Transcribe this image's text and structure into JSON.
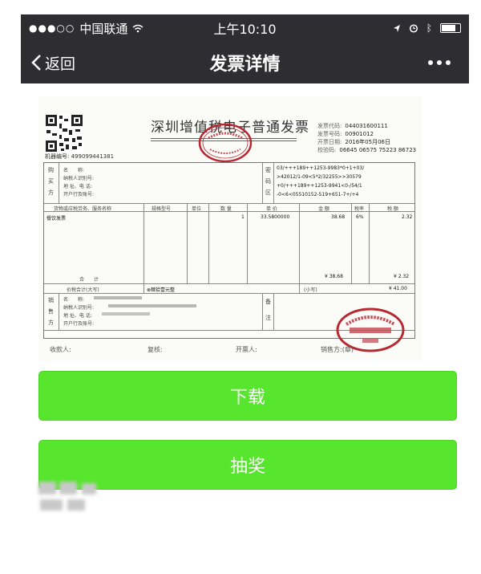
{
  "status_bar": {
    "carrier": "中国联通",
    "time": "上午10:10"
  },
  "nav": {
    "back_label": "返回",
    "title": "发票详情",
    "more_label": "•••"
  },
  "invoice": {
    "title": "深圳增值税电子普通发票",
    "meta": [
      {
        "k": "发票代码:",
        "v": "044031600111"
      },
      {
        "k": "发票号码:",
        "v": "00901012"
      },
      {
        "k": "开票日期:",
        "v": "2016年05月06日"
      },
      {
        "k": "校验码:",
        "v": "06645 06575 75223 86723"
      }
    ],
    "machine_no": "机器编号: 499099441381",
    "buyer_label": [
      "购",
      "买",
      "方"
    ],
    "buyer_fields": [
      "名　　称:",
      "纳税人识别号:",
      "地 址、电 话:",
      "开户行及账号:"
    ],
    "cipher_label": [
      "密",
      "码",
      "区"
    ],
    "cipher_lines": [
      "03/+++189++1253-9983*0+1+03/",
      ">42012/1-09<5*2/32255>>30579",
      "+0/+++189++1253-9941<0-/54/1",
      "-0<6<05510152-519+651-7+/+4"
    ],
    "item_headers": [
      "货物或应税劳务、服务名称",
      "规格型号",
      "单位",
      "数 量",
      "单 价",
      "金 额",
      "税率",
      "税 额"
    ],
    "item_row": {
      "name": "餐饮发票",
      "qty": "1",
      "price": "33.5800000",
      "amount": "38.68",
      "rate": "6%",
      "tax": "2.32"
    },
    "subtotal_label": "合　　计",
    "subtotal_amount": "¥ 38.68",
    "subtotal_tax": "¥ 2.32",
    "total_label": "价税合计(大写)",
    "total_upper": "⊗肆拾壹元整",
    "total_small_label": "(小写)",
    "total_small": "¥ 41.00",
    "seller_label": [
      "销",
      "售",
      "方"
    ],
    "seller_fields": [
      "名　　称:",
      "纳税人识别号:",
      "地 址、电 话:",
      "开户行及账号:"
    ],
    "remark_label": [
      "备",
      "注"
    ],
    "footer": [
      "收款人:",
      "复核:",
      "开票人:",
      "销售方:(章)"
    ]
  },
  "buttons": {
    "download": "下载",
    "lottery": "抽奖"
  },
  "colors": {
    "nav_bg": "#2e2d32",
    "button_green": "#57e52e",
    "seal_red": "#b82830"
  }
}
